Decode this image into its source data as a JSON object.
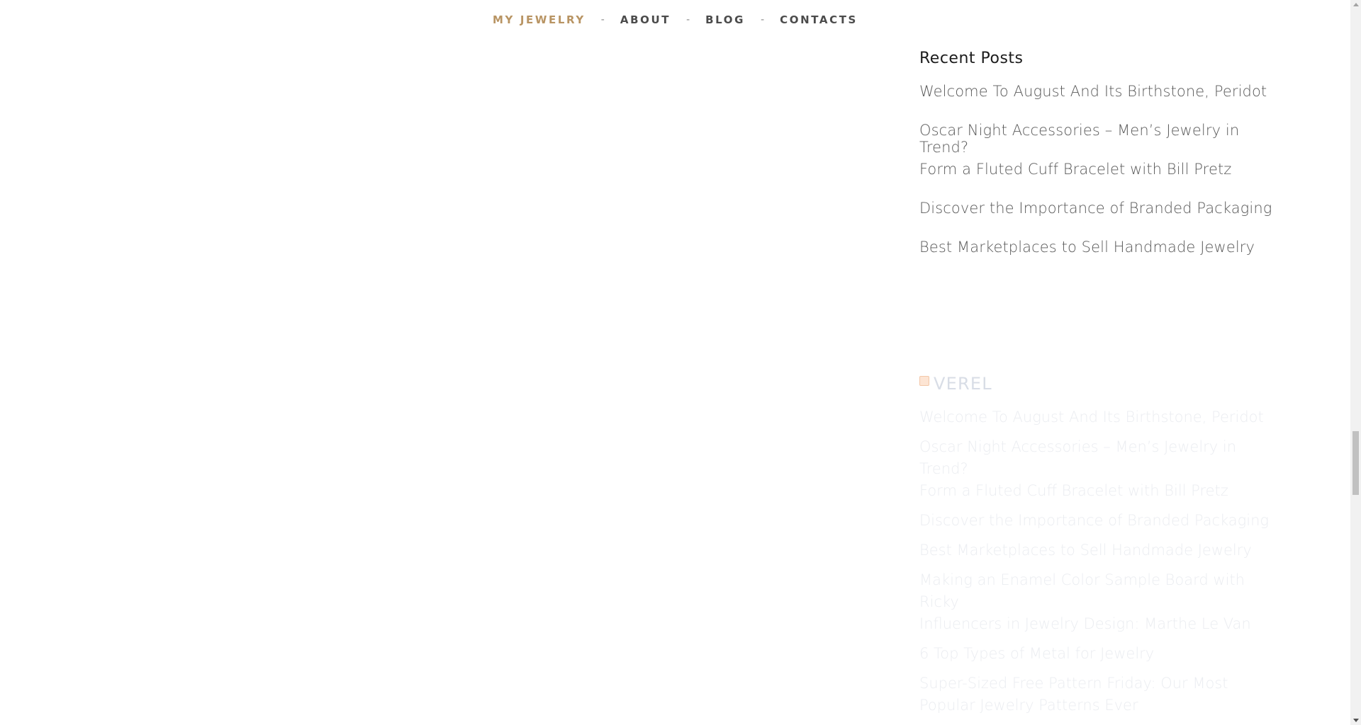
{
  "nav": {
    "items": [
      {
        "label": "MY JEWELRY",
        "active": true
      },
      {
        "label": "ABOUT",
        "active": false
      },
      {
        "label": "BLOG",
        "active": false
      },
      {
        "label": "CONTACTS",
        "active": false
      }
    ],
    "separator": "-"
  },
  "recent_posts": {
    "title": "Recent Posts",
    "items": [
      "Welcome To August And Its Birthstone, Peridot",
      "Oscar Night Accessories – Men’s Jewelry in Trend?",
      "Form a Fluted Cuff Bracelet with Bill Pretz",
      "Discover the Importance of Branded Packaging",
      "Best Marketplaces to Sell Handmade Jewelry"
    ]
  },
  "rss": {
    "title": "VEREL",
    "items": [
      "Welcome To August And Its Birthstone, Peridot",
      "Oscar Night Accessories – Men’s Jewelry in Trend?",
      "Form a Fluted Cuff Bracelet with Bill Pretz",
      "Discover the Importance of Branded Packaging",
      "Best Marketplaces to Sell Handmade Jewelry",
      "Making an Enamel Color Sample Board with Ricky",
      "Influencers in Jewelry Design: Marthe Le Van",
      "6 Top Types of Metal for Jewelry",
      "Super-Sized Free Pattern Friday: Our Most Popular Jewelry Patterns Ever"
    ]
  },
  "colors": {
    "accent": "#b89463",
    "nav_text": "#4b4b4b",
    "faded_text": "#ebedf1"
  },
  "icons": {
    "rss": "rss-icon"
  }
}
